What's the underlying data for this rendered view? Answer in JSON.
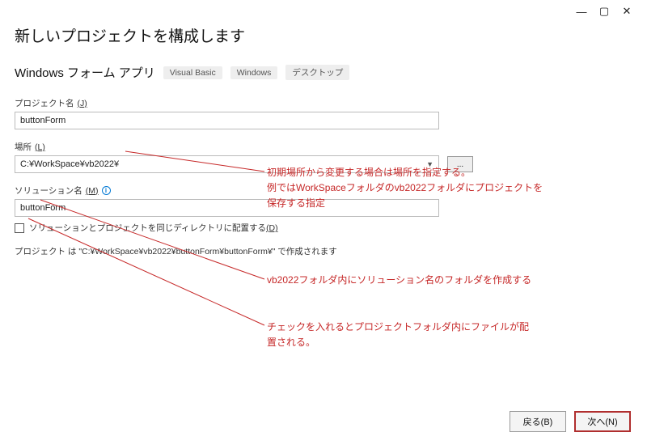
{
  "window": {
    "min": "—",
    "max": "▢",
    "close": "✕"
  },
  "title": "新しいプロジェクトを構成します",
  "subtitle": "Windows フォーム アプリ",
  "tags": [
    "Visual Basic",
    "Windows",
    "デスクトップ"
  ],
  "projectName": {
    "label": "プロジェクト名",
    "accel": "(J)",
    "value": "buttonForm"
  },
  "location": {
    "label": "場所",
    "accel": "(L)",
    "value": "C:¥WorkSpace¥vb2022¥",
    "browse": "..."
  },
  "solutionName": {
    "label": "ソリューション名",
    "accel": "(M)",
    "value": "buttonForm"
  },
  "checkbox": {
    "prefix": "ソリューションとプロジェクトを同じディレクトリに配置する",
    "accel": "(D)"
  },
  "projectNote": "プロジェクト は \"C:¥WorkSpace¥vb2022¥buttonForm¥buttonForm¥\" で作成されます",
  "annotations": {
    "a1_l1": "初期場所から変更する場合は場所を指定する。",
    "a1_l2": "例ではWorkSpaceフォルダのvb2022フォルダにプロジェクトを",
    "a1_l3": "保存する指定",
    "a2": "vb2022フォルダ内にソリューション名のフォルダを作成する",
    "a3_l1": "チェックを入れるとプロジェクトフォルダ内にファイルが配",
    "a3_l2": "置される。"
  },
  "footer": {
    "back": "戻る(B)",
    "next": "次へ(N)"
  }
}
